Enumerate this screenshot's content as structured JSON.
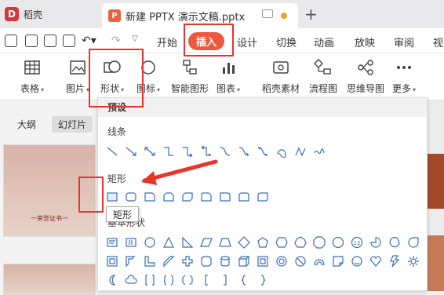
{
  "app": {
    "name": "稻壳"
  },
  "document_tab": {
    "title": "新建 PPTX 演示文稿.pptx",
    "new_tab": "+"
  },
  "menu": {
    "items": [
      "开始",
      "插入",
      "设计",
      "切换",
      "动画",
      "放映",
      "审阅",
      "视"
    ],
    "active": "插入"
  },
  "ribbon": {
    "items": [
      {
        "label": "表格",
        "dropdown": true,
        "icon": "table-icon"
      },
      {
        "label": "图片",
        "dropdown": true,
        "icon": "picture-icon"
      },
      {
        "label": "形状",
        "dropdown": true,
        "icon": "shapes-icon"
      },
      {
        "label": "图标",
        "dropdown": true,
        "icon": "icon-library-icon"
      },
      {
        "label": "智能图形",
        "dropdown": false,
        "icon": "smartart-icon"
      },
      {
        "label": "图表",
        "dropdown": true,
        "icon": "chart-icon"
      },
      {
        "label": "稻壳素材",
        "dropdown": false,
        "icon": "docer-material-icon"
      },
      {
        "label": "流程图",
        "dropdown": false,
        "icon": "flowchart-icon"
      },
      {
        "label": "思维导图",
        "dropdown": false,
        "icon": "mindmap-icon"
      },
      {
        "label": "更多",
        "dropdown": true,
        "icon": "more-icon"
      }
    ]
  },
  "view_tabs": {
    "outline": "大纲",
    "slides": "幻灯片"
  },
  "shapes_panel": {
    "header": "预设",
    "sections": {
      "lines": "线条",
      "rectangles": "矩形",
      "basic": "基本形状"
    }
  },
  "tooltip": {
    "text": "矩形"
  },
  "thumbnail": {
    "caption": "一荣誉证书一"
  },
  "colors": {
    "accent": "#ea5a3d",
    "highlight_box": "#e8342a",
    "shape_stroke": "#3b6fb6"
  }
}
